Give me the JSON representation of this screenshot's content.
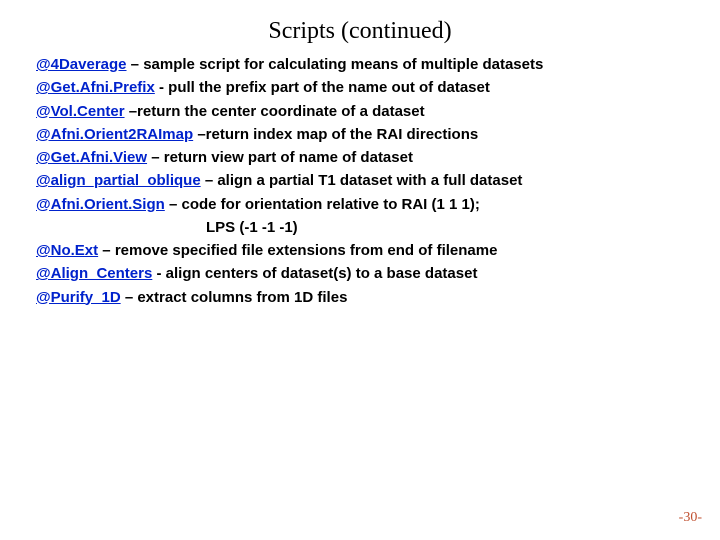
{
  "title": "Scripts (continued)",
  "items": [
    {
      "name": "@4Daverage",
      "sep": " – ",
      "desc": "sample script for calculating means of multiple datasets"
    },
    {
      "name": "@Get.Afni.Prefix",
      "sep": "  - ",
      "desc": "pull the prefix part of the name out of dataset"
    },
    {
      "name": "@Vol.Center",
      "sep": " –",
      "desc": "return the center coordinate of a dataset"
    },
    {
      "name": "@Afni.Orient2RAImap",
      "sep": " –",
      "desc": "return index map of the RAI directions"
    },
    {
      "name": "@Get.Afni.View",
      "sep": " – ",
      "desc": "return view part of name of dataset"
    },
    {
      "name": "@align_partial_oblique",
      "sep": " – ",
      "desc": "align a partial T1 dataset with a full dataset"
    },
    {
      "name": "@Afni.Orient.Sign",
      "sep": " – ",
      "desc": "code for orientation relative to RAI (1 1 1);"
    },
    {
      "name": "",
      "sep": "",
      "desc": "LPS (-1 -1 -1)",
      "indent": true
    },
    {
      "name": "@No.Ext",
      "sep": " – ",
      "desc": "remove specified file extensions from end of filename"
    },
    {
      "name": "@Align_Centers",
      "sep": " - ",
      "desc": "align centers of dataset(s) to a base dataset"
    },
    {
      "name": "@Purify_1D",
      "sep": " – ",
      "desc": "extract columns from 1D files"
    }
  ],
  "page_number": "-30-"
}
